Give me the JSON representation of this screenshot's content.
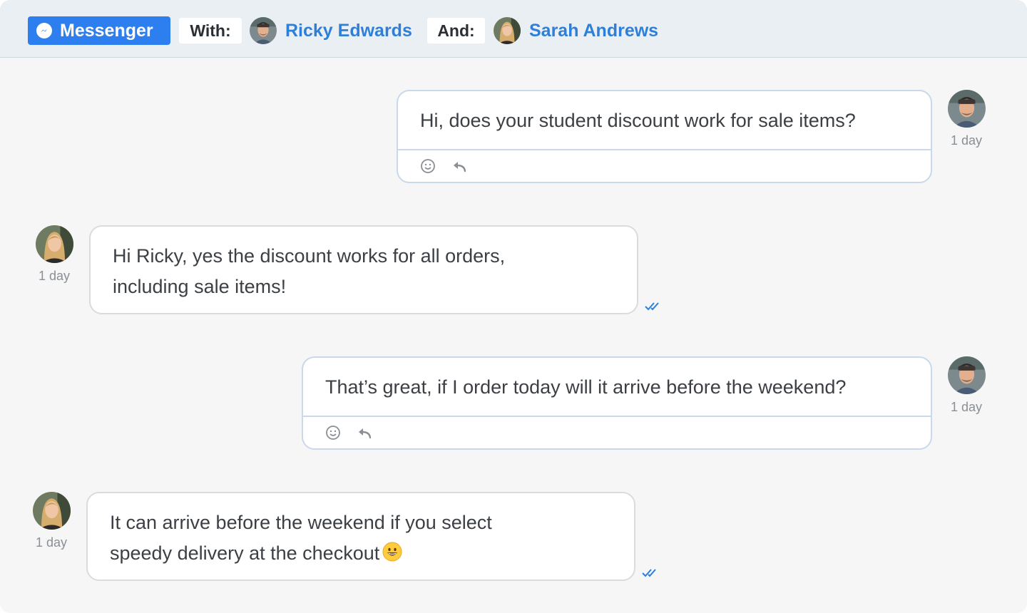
{
  "header": {
    "channel_label": "Messenger",
    "with_label": "With:",
    "and_label": "And:",
    "participants": [
      {
        "name": "Ricky Edwards",
        "avatar": "ricky-avatar"
      },
      {
        "name": "Sarah Andrews",
        "avatar": "sarah-avatar"
      }
    ]
  },
  "messages": [
    {
      "direction": "outgoing",
      "sender": "Ricky Edwards",
      "text": "Hi, does your student discount work for sale items?",
      "time": "1 day",
      "actions": [
        "emoji-reaction-icon",
        "reply-icon"
      ]
    },
    {
      "direction": "incoming",
      "sender": "Sarah Andrews",
      "text": "Hi Ricky, yes the discount works for all orders, including sale items!",
      "time": "1 day",
      "status": "read-double-check-icon"
    },
    {
      "direction": "outgoing",
      "sender": "Ricky Edwards",
      "text": "That’s great, if I order today will it arrive before the weekend?",
      "time": "1 day",
      "actions": [
        "emoji-reaction-icon",
        "reply-icon"
      ]
    },
    {
      "direction": "incoming",
      "sender": "Sarah Andrews",
      "text": "It can arrive before the weekend if you select speedy delivery at the checkout",
      "emoji": "grinning-face-emoji",
      "time": "1 day",
      "status": "read-double-check-icon"
    }
  ],
  "colors": {
    "brand": "#2d7ff0",
    "participant_name": "#2f7fd8",
    "header_bg": "#e9eff2",
    "canvas_bg": "#f6f6f6",
    "outgoing_border": "#c9d8ea",
    "incoming_border": "#d9dbdf",
    "read_check": "#2f7fd8"
  }
}
